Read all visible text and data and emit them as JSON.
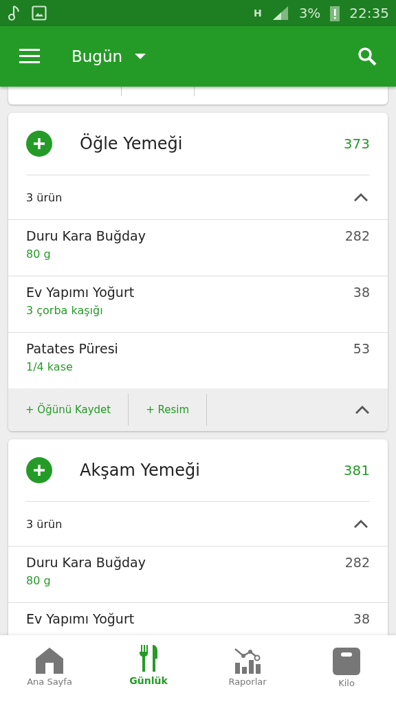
{
  "status_bar": {
    "network": "H",
    "battery": "3%",
    "time": "22:35"
  },
  "app_bar": {
    "title": "Bugün"
  },
  "meals": [
    {
      "name": "Öğle Yemeği",
      "calories": "373",
      "item_count": "3 ürün",
      "expanded": true,
      "items": [
        {
          "name": "Duru Kara Buğday",
          "amount": "80  g",
          "calories": "282"
        },
        {
          "name": "Ev Yapımı Yoğurt",
          "amount": "3  çorba kaşığı",
          "calories": "38"
        },
        {
          "name": "Patates Püresi",
          "amount": "1/4 kase",
          "calories": "53"
        }
      ],
      "actions": [
        "+ Öğünü Kaydet",
        "+ Resim"
      ]
    },
    {
      "name": "Akşam Yemeği",
      "calories": "381",
      "item_count": "3 ürün",
      "expanded": true,
      "items": [
        {
          "name": "Duru Kara Buğday",
          "amount": "80  g",
          "calories": "282"
        },
        {
          "name": "Ev Yapımı Yoğurt",
          "calories": "38"
        }
      ]
    }
  ],
  "bottom_nav": [
    {
      "kind": "home",
      "label": "Ana Sayfa",
      "selected": false
    },
    {
      "kind": "diary",
      "label": "Günlük",
      "selected": true
    },
    {
      "kind": "reports",
      "label": "Raporlar",
      "selected": false
    },
    {
      "kind": "weight",
      "label": "Kilo",
      "selected": false
    }
  ]
}
